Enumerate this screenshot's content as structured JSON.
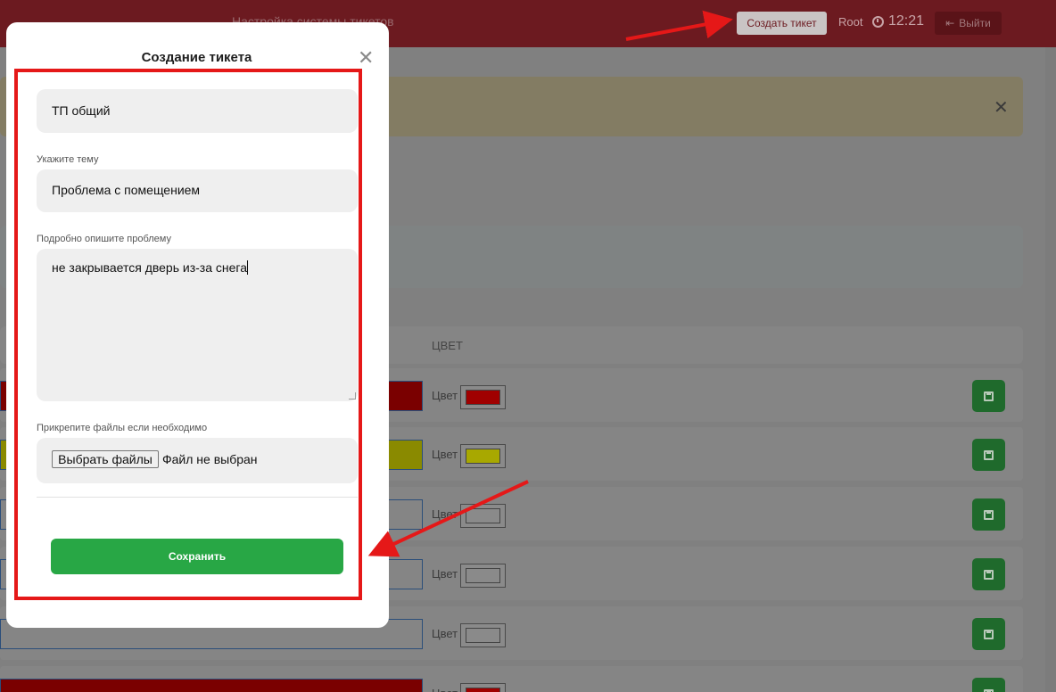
{
  "header": {
    "title": "Настройка системы тикетов",
    "create_button": "Создать тикет",
    "user": "Root",
    "time": "12:21",
    "logout_button": "Выйти"
  },
  "background": {
    "table_header_color": "ЦВЕТ",
    "color_label": "Цвет",
    "row_colors": [
      "#a00000",
      "#a8a800",
      "#ffffff",
      "#ffffff",
      "#ffffff",
      "#a00000"
    ],
    "row_field_fills": [
      "#7a0000",
      "#8a8a00",
      "#858585",
      "#858585",
      "#858585",
      "#7a0000"
    ]
  },
  "modal": {
    "title": "Создание тикета",
    "queue_value": "ТП общий",
    "subject_label": "Укажите тему",
    "subject_value": "Проблема с помещением",
    "description_label": "Подробно опишите проблему",
    "description_value": "не закрывается дверь из-за снега",
    "attach_label": "Прикрепите файлы если необходимо",
    "file_button": "Выбрать файлы",
    "file_status": "Файл не выбран",
    "save_button": "Сохранить"
  },
  "colors": {
    "header": "#6c1a20",
    "accent_green": "#28a745",
    "highlight_red": "#e51818"
  }
}
